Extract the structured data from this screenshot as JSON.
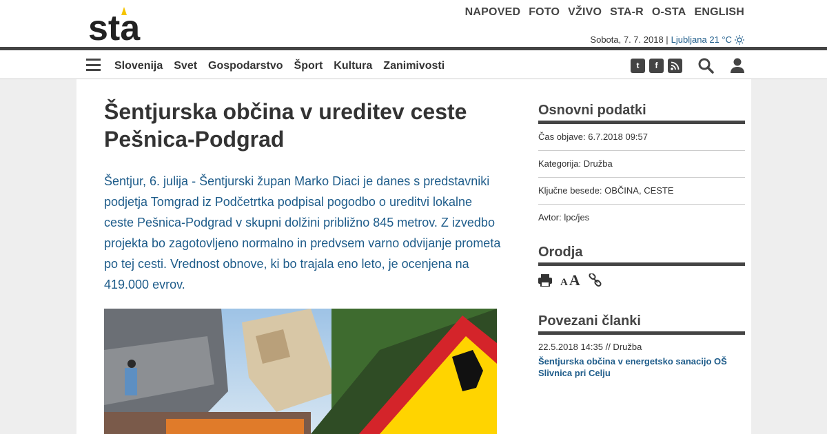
{
  "brand": {
    "logo_text": "sta",
    "accent": "#f5c400",
    "link_color": "#1e5c8a"
  },
  "topnav": [
    "NAPOVED",
    "FOTO",
    "VŽIVO",
    "STA-R",
    "O-STA",
    "ENGLISH"
  ],
  "dateline": {
    "date": "Sobota, 7. 7. 2018 |",
    "weather": "Ljubljana 21 °C",
    "weather_icon": "sun-icon"
  },
  "mainnav": [
    "Slovenija",
    "Svet",
    "Gospodarstvo",
    "Šport",
    "Kultura",
    "Zanimivosti"
  ],
  "social": {
    "twitter": "t",
    "facebook": "f",
    "rss": "r"
  },
  "article": {
    "title": "Šentjurska občina v ureditev ceste Pešnica-Podgrad",
    "lead": "Šentjur, 6. julija - Šentjurski župan Marko Diaci je danes s predstavniki podjetja Tomgrad iz Podčetrtka podpisal pogodbo o ureditvi lokalne ceste Pešnica-Podgrad v skupni dolžini približno 845 metrov. Z izvedbo projekta bo zagotovljeno normalno in predvsem varno odvijanje prometa po tej cesti. Vrednost obnove, ki bo trajala eno leto, je ocenjena na 419.000 evrov."
  },
  "sidebar": {
    "basic": {
      "title": "Osnovni podatki",
      "rows": [
        "Čas objave: 6.7.2018 09:57",
        "Kategorija: Družba",
        "Ključne besede: OBČINA, CESTE",
        "Avtor: lpc/jes"
      ]
    },
    "tools": {
      "title": "Orodja",
      "small_a": "A",
      "big_a": "A"
    },
    "related": {
      "title": "Povezani članki",
      "meta": "22.5.2018 14:35 // Družba",
      "link": "Šentjurska občina v energetsko sanacijo OŠ Slivnica pri Celju"
    }
  }
}
